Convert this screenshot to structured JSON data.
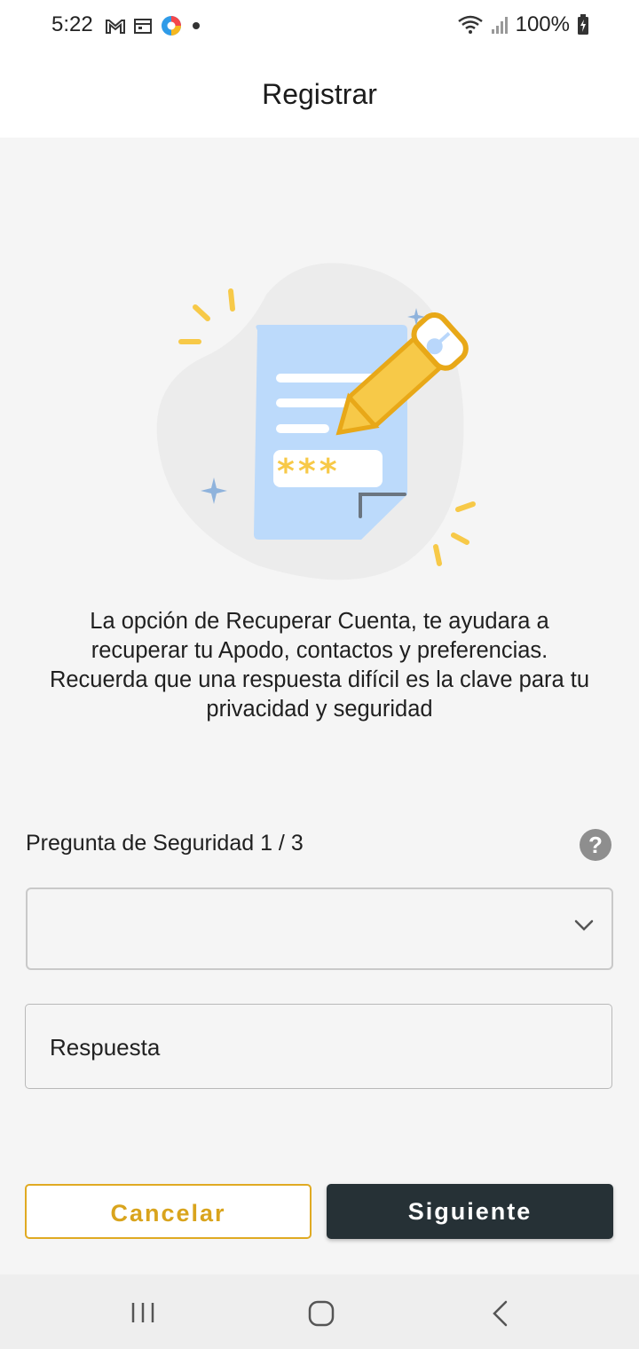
{
  "status_bar": {
    "time": "5:22",
    "battery": "100%",
    "left_icons": [
      "gmail-icon",
      "calendar-icon",
      "app-icon",
      "dot-icon"
    ],
    "right_icons": [
      "wifi-icon",
      "signal-icon",
      "battery-charging-icon"
    ]
  },
  "header": {
    "title": "Registrar"
  },
  "info": {
    "lines": [
      "La opción de Recuperar Cuenta, te ayudara a",
      "recuperar tu Apodo, contactos y preferencias.",
      "Recuerda que una respuesta difícil es la clave para tu",
      "privacidad y seguridad"
    ]
  },
  "security": {
    "label": "Pregunta de Seguridad 1 / 3",
    "help_icon": "?",
    "selected_question": "",
    "answer_placeholder": "Respuesta"
  },
  "buttons": {
    "cancel": "Cancelar",
    "next": "Siguiente"
  },
  "colors": {
    "accent": "#e0aa22",
    "primary_button": "#263136",
    "background": "#f5f5f5",
    "illustration_doc": "#bcdafb",
    "illustration_pen": "#f7c948"
  },
  "nav": {
    "icons": [
      "recent-apps-icon",
      "home-icon",
      "back-icon"
    ]
  }
}
